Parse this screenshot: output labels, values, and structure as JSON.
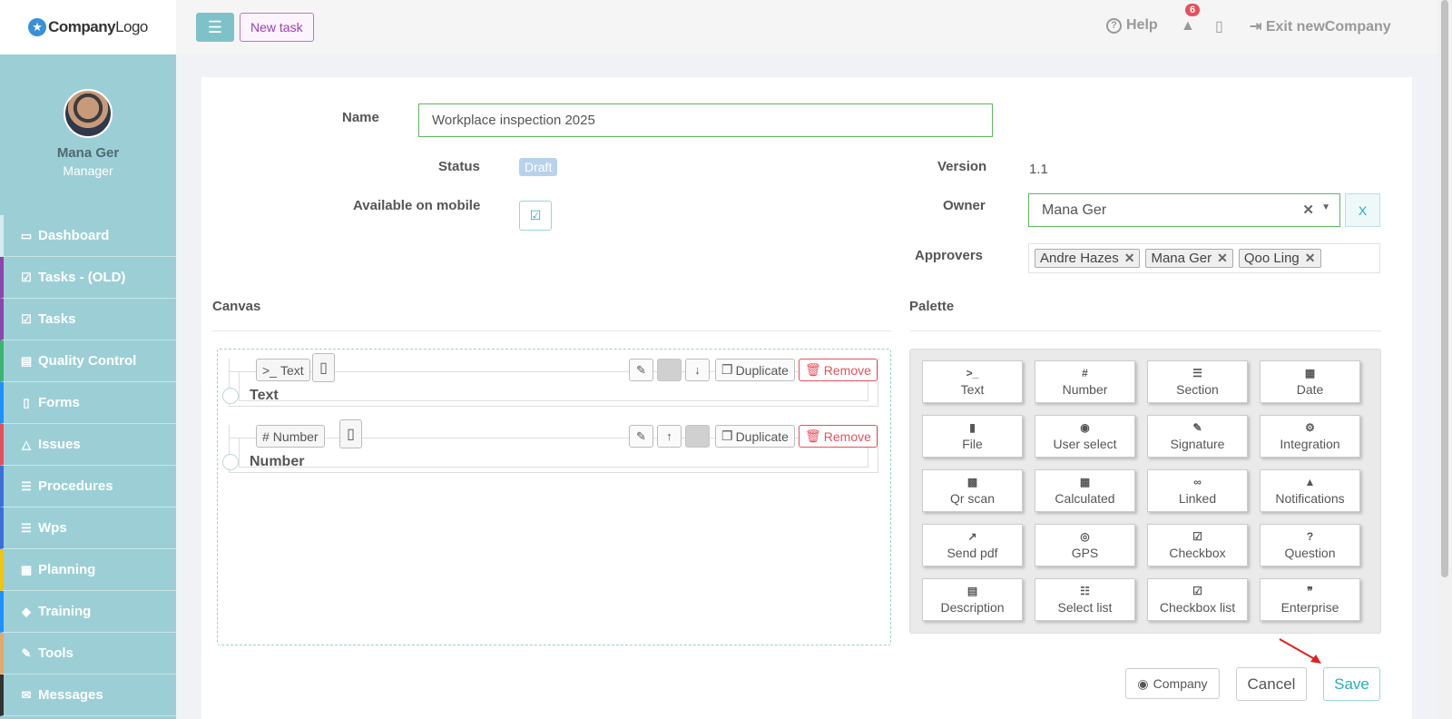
{
  "logo": {
    "brand": "Company",
    "suffix": "Logo"
  },
  "profile": {
    "name": "Mana Ger",
    "role": "Manager"
  },
  "nav": [
    {
      "label": "Dashboard",
      "icon": "desktop-icon",
      "glyph": "▭",
      "color": "#d7ecef"
    },
    {
      "label": "Tasks - (OLD)",
      "icon": "check-square-icon",
      "glyph": "☑",
      "color": "#8e44ad"
    },
    {
      "label": "Tasks",
      "icon": "check-square-icon",
      "glyph": "☑",
      "color": "#8e44ad"
    },
    {
      "label": "Quality Control",
      "icon": "book-icon",
      "glyph": "▤",
      "color": "#3cb371"
    },
    {
      "label": "Forms",
      "icon": "file-icon",
      "glyph": "▯",
      "color": "#1e90ff"
    },
    {
      "label": "Issues",
      "icon": "bell-icon",
      "glyph": "△",
      "color": "#e7505a"
    },
    {
      "label": "Procedures",
      "icon": "list-icon",
      "glyph": "☰",
      "color": "#3a6fd9"
    },
    {
      "label": "Wps",
      "icon": "list-icon",
      "glyph": "☰",
      "color": "#3a6fd9"
    },
    {
      "label": "Planning",
      "icon": "calendar-check-icon",
      "glyph": "▦",
      "color": "#f1c40f"
    },
    {
      "label": "Training",
      "icon": "graduation-cap-icon",
      "glyph": "◆",
      "color": "#1e90ff"
    },
    {
      "label": "Tools",
      "icon": "wrench-icon",
      "glyph": "✎",
      "color": "#e5a86b"
    },
    {
      "label": "Messages",
      "icon": "envelope-icon",
      "glyph": "✉",
      "color": "#333333"
    }
  ],
  "topbar": {
    "new_task": "New task",
    "help": "Help",
    "notification_count": "6",
    "exit": "Exit newCompany"
  },
  "form": {
    "name_label": "Name",
    "name_value": "Workplace inspection 2025",
    "status_label": "Status",
    "status_value": "Draft",
    "mobile_label": "Available on mobile",
    "version_label": "Version",
    "version_value": "1.1",
    "owner_label": "Owner",
    "owner_value": "Mana Ger",
    "owner_clear": "X",
    "approvers_label": "Approvers",
    "approvers": [
      "Andre Hazes",
      "Mana Ger",
      "Qoo Ling"
    ]
  },
  "canvas": {
    "title": "Canvas",
    "fields": [
      {
        "type_label": "Text",
        "type_glyph": ">_",
        "label": "Text",
        "duplicate": "Duplicate",
        "remove": "Remove"
      },
      {
        "type_label": "Number",
        "type_glyph": "#",
        "label": "Number",
        "duplicate": "Duplicate",
        "remove": "Remove"
      }
    ]
  },
  "palette": {
    "title": "Palette",
    "items": [
      {
        "label": "Text",
        "icon": "terminal-icon",
        "glyph": ">_"
      },
      {
        "label": "Number",
        "icon": "hashtag-icon",
        "glyph": "#"
      },
      {
        "label": "Section",
        "icon": "indent-icon",
        "glyph": "☰"
      },
      {
        "label": "Date",
        "icon": "calendar-icon",
        "glyph": "▦"
      },
      {
        "label": "File",
        "icon": "file-icon",
        "glyph": "▮"
      },
      {
        "label": "User select",
        "icon": "user-circle-icon",
        "glyph": "◉"
      },
      {
        "label": "Signature",
        "icon": "pen-square-icon",
        "glyph": "✎"
      },
      {
        "label": "Integration",
        "icon": "cogs-icon",
        "glyph": "⚙"
      },
      {
        "label": "Qr scan",
        "icon": "qrcode-icon",
        "glyph": "▩"
      },
      {
        "label": "Calculated",
        "icon": "calculator-icon",
        "glyph": "▦"
      },
      {
        "label": "Linked",
        "icon": "link-icon",
        "glyph": "∞"
      },
      {
        "label": "Notifications",
        "icon": "bell-icon",
        "glyph": "▲"
      },
      {
        "label": "Send pdf",
        "icon": "share-square-icon",
        "glyph": "↗"
      },
      {
        "label": "GPS",
        "icon": "compass-icon",
        "glyph": "◎"
      },
      {
        "label": "Checkbox",
        "icon": "check-square-icon",
        "glyph": "☑"
      },
      {
        "label": "Question",
        "icon": "question-circle-icon",
        "glyph": "?"
      },
      {
        "label": "Description",
        "icon": "file-text-icon",
        "glyph": "▤"
      },
      {
        "label": "Select list",
        "icon": "list-ol-icon",
        "glyph": "☷"
      },
      {
        "label": "Checkbox list",
        "icon": "check-square-icon",
        "glyph": "☑"
      },
      {
        "label": "Enterprise",
        "icon": "quote-right-icon",
        "glyph": "❞"
      }
    ]
  },
  "buttons": {
    "company": "Company",
    "cancel": "Cancel",
    "save": "Save"
  }
}
